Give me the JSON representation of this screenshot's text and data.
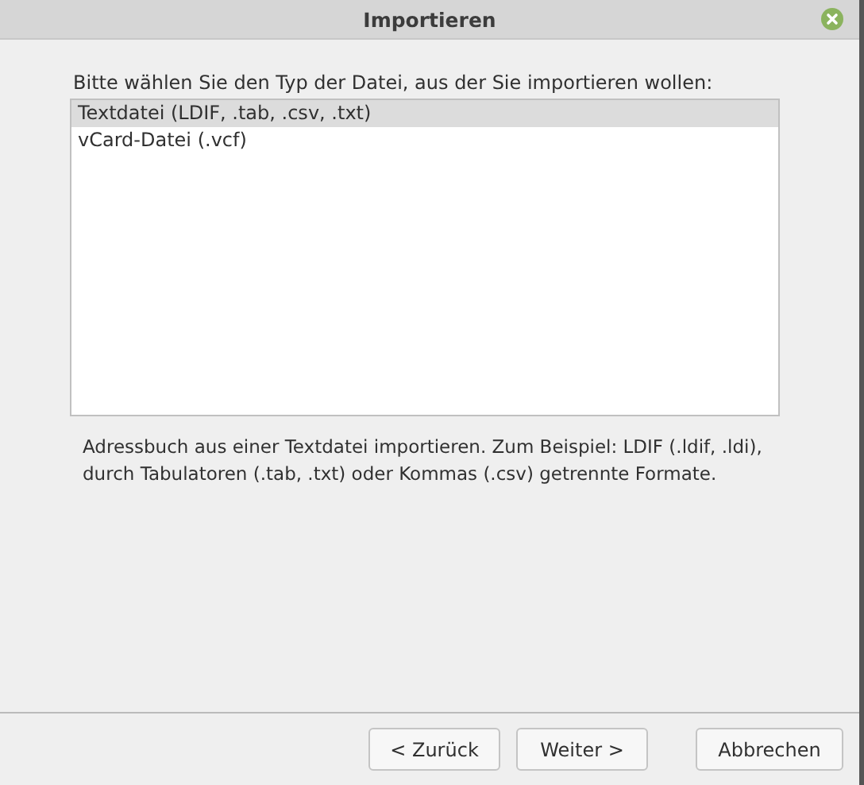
{
  "window": {
    "title": "Importieren"
  },
  "prompt": "Bitte wählen Sie den Typ der Datei, aus der Sie importieren wollen:",
  "file_types": [
    {
      "label": "Textdatei (LDIF, .tab, .csv, .txt)",
      "selected": true
    },
    {
      "label": "vCard-Datei (.vcf)",
      "selected": false
    }
  ],
  "description": "Adressbuch aus einer Textdatei importieren. Zum Beispiel: LDIF (.ldif, .ldi), durch Tabulatoren (.tab, .txt) oder Kommas (.csv) getrennte Formate.",
  "buttons": [
    {
      "label": "< Zurück"
    },
    {
      "label": "Weiter >"
    },
    {
      "label": "Abbrechen"
    }
  ]
}
